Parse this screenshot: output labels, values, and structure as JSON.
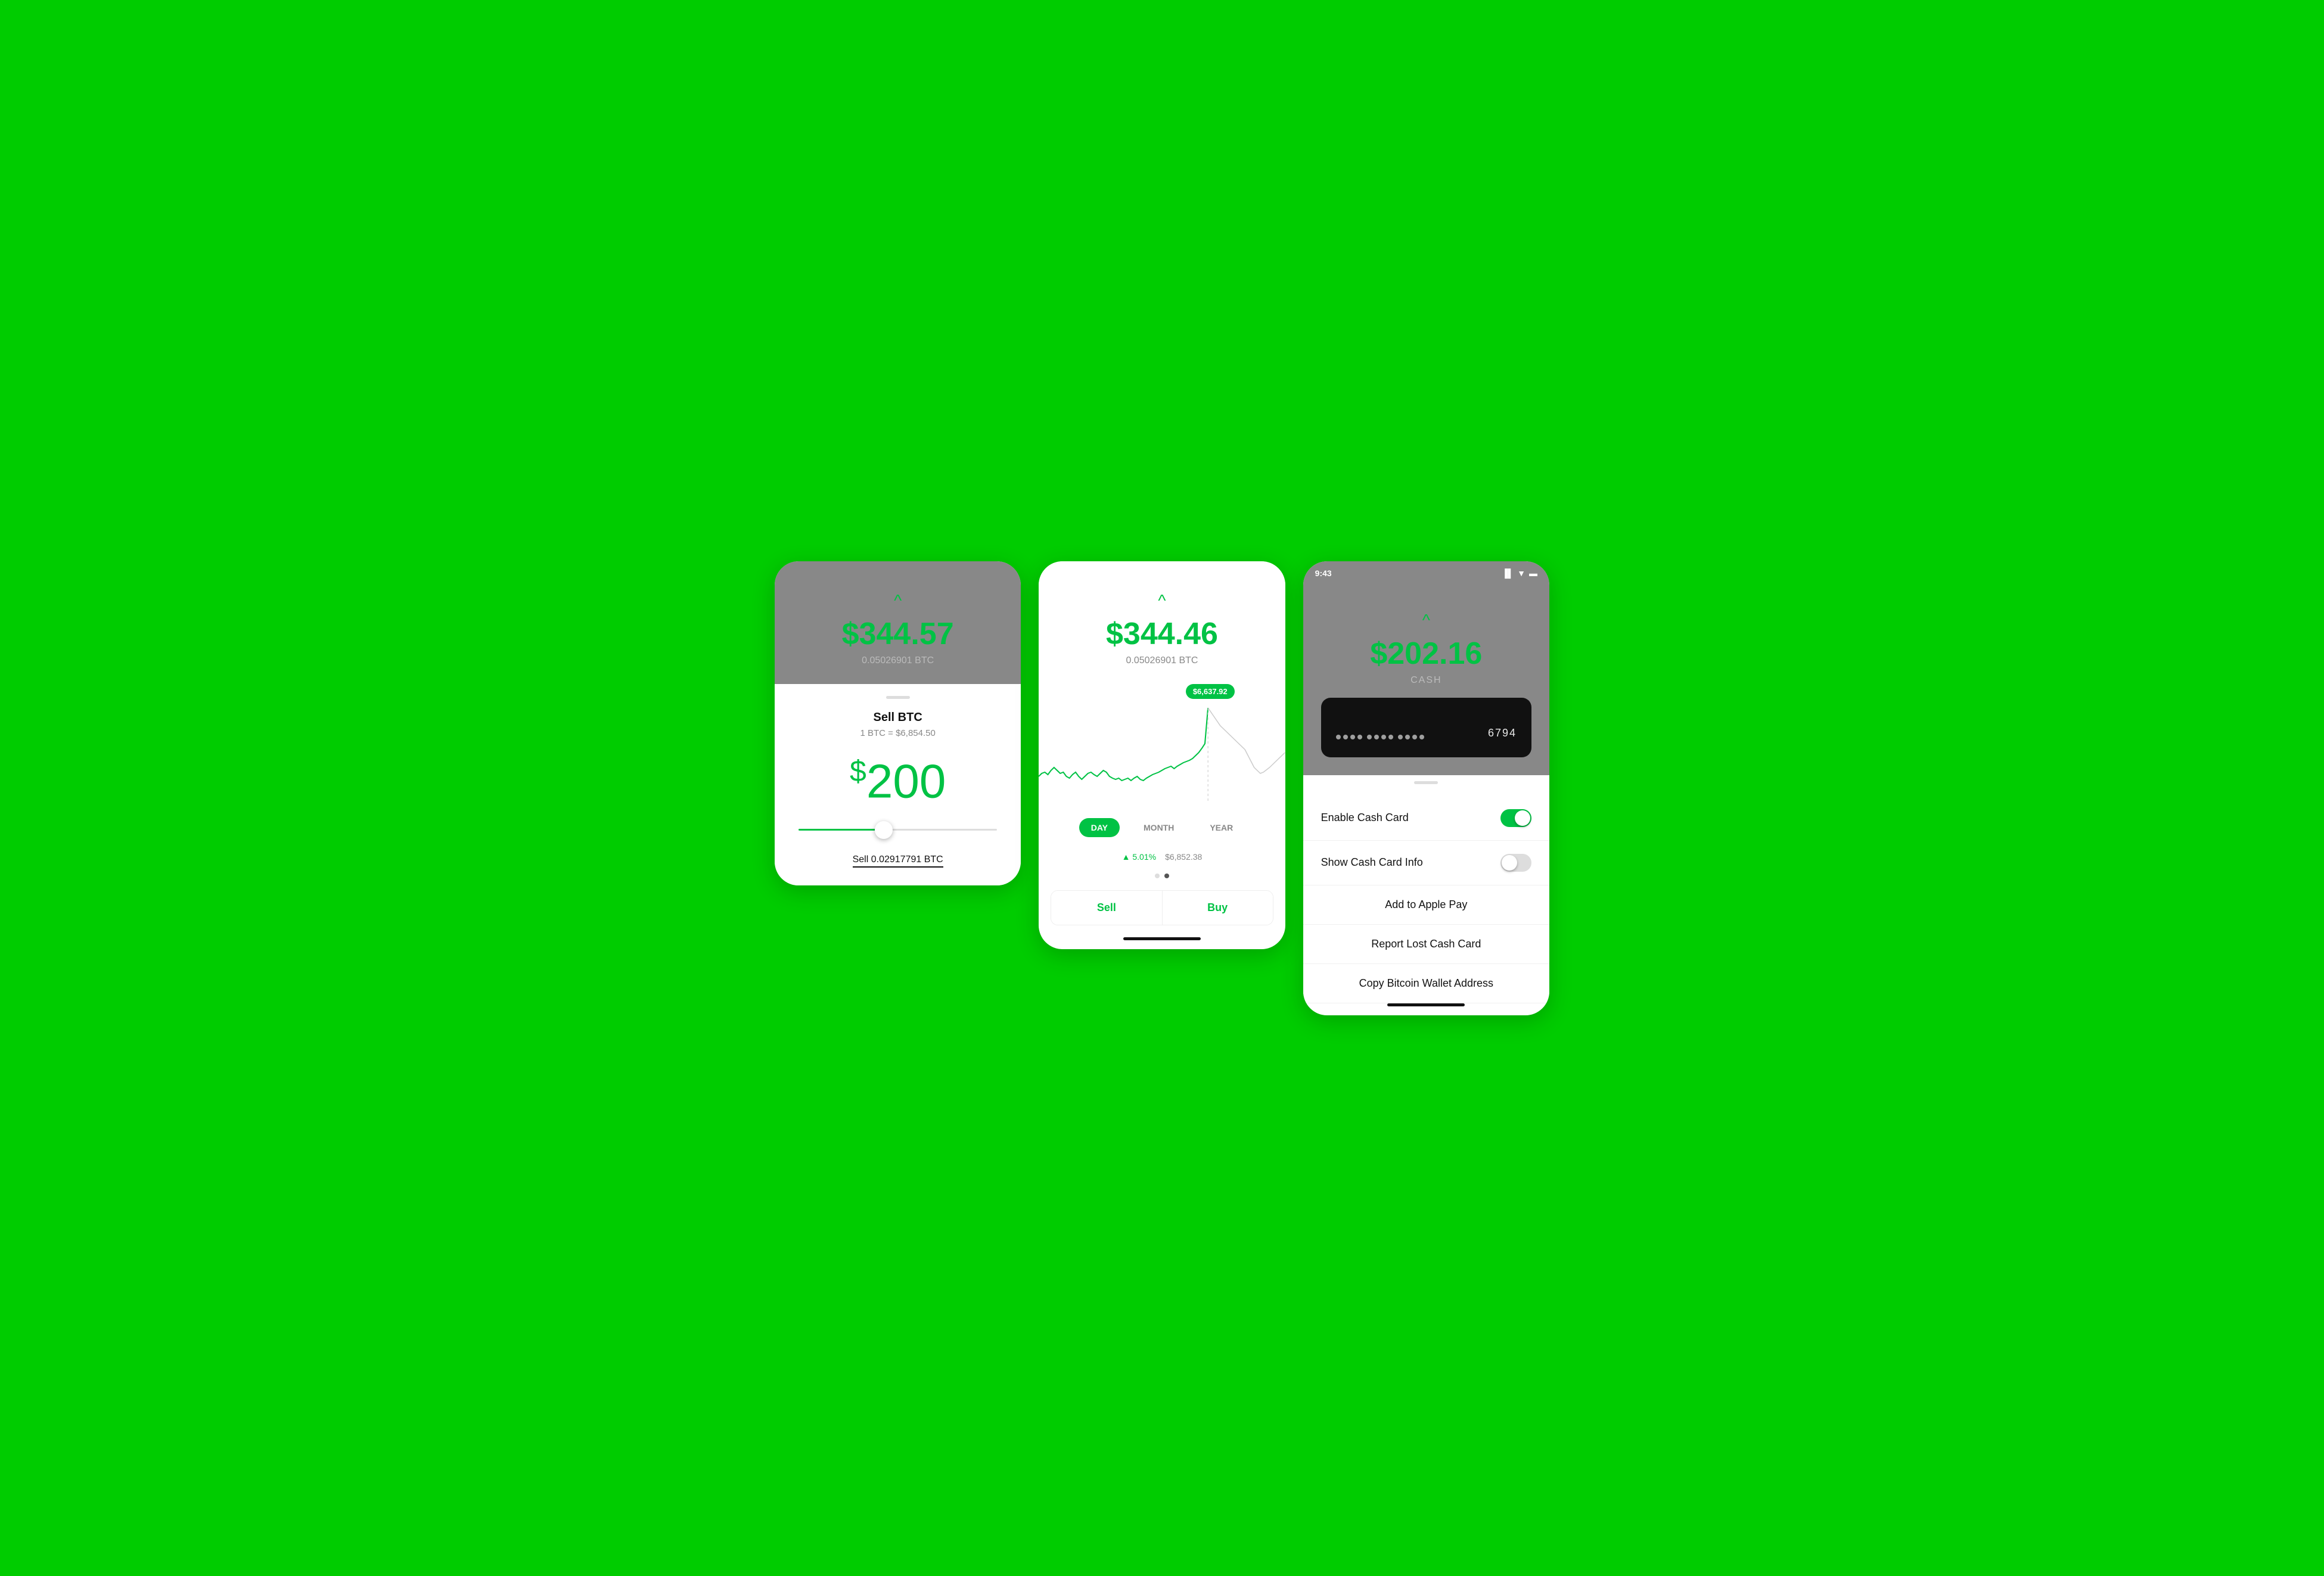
{
  "background_color": "#00cc00",
  "screen1": {
    "btc_balance": "$344.57",
    "btc_amount": "0.05026901 BTC",
    "sell_title": "Sell BTC",
    "sell_rate": "1 BTC = $6,854.50",
    "sell_amount_dollar": "$",
    "sell_amount_number": "200",
    "sell_btc_label": "Sell 0.02917791 BTC",
    "chevron": "^"
  },
  "screen2": {
    "btc_balance": "$344.46",
    "btc_amount": "0.05026901 BTC",
    "tooltip_price": "$6,637.92",
    "time_tabs": [
      "DAY",
      "MONTH",
      "YEAR"
    ],
    "active_tab": "DAY",
    "stat_percent": "▲ 5.01%",
    "stat_price": "$6,852.38",
    "sell_label": "Sell",
    "buy_label": "Buy",
    "chevron": "^"
  },
  "screen3": {
    "status_time": "9:43",
    "cash_balance": "$202.16",
    "cash_label": "CASH",
    "card_last4": "6794",
    "settings": [
      {
        "label": "Enable Cash Card",
        "type": "toggle",
        "state": "on"
      },
      {
        "label": "Show Cash Card Info",
        "type": "toggle",
        "state": "off"
      },
      {
        "label": "Add to Apple Pay",
        "type": "action"
      },
      {
        "label": "Report Lost Cash Card",
        "type": "action"
      },
      {
        "label": "Copy Bitcoin Wallet Address",
        "type": "action"
      }
    ],
    "chevron": "^"
  }
}
